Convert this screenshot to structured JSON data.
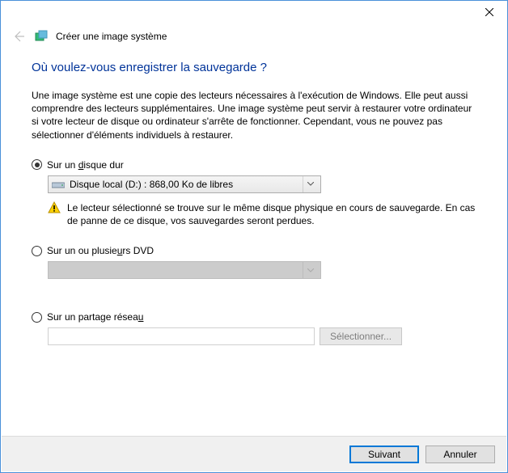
{
  "window": {
    "title": "Créer une image système"
  },
  "heading": "Où voulez-vous enregistrer la sauvegarde ?",
  "description": "Une image système est une copie des lecteurs nécessaires à l'exécution de Windows. Elle peut aussi comprendre des lecteurs supplémentaires. Une image système peut servir à restaurer votre ordinateur si votre lecteur de disque ou ordinateur s'arrête de fonctionner. Cependant, vous ne pouvez pas sélectionner d'éléments individuels à restaurer.",
  "options": {
    "hard_disk": {
      "label_pre": "Sur un ",
      "label_u": "d",
      "label_post": "isque dur",
      "selected_drive": "Disque local (D:) : 868,00 Ko de libres",
      "warning": "Le lecteur sélectionné se trouve sur le même disque physique en cours de sauvegarde. En cas de panne de ce disque, vos sauvegardes seront perdues."
    },
    "dvd": {
      "label_pre": "Sur un ou plusie",
      "label_u": "u",
      "label_post": "rs DVD"
    },
    "network": {
      "label_pre": "Sur un partage résea",
      "label_u": "u",
      "label_post": "",
      "select_button": "Sélectionner..."
    }
  },
  "footer": {
    "next": "Suivant",
    "cancel": "Annuler"
  }
}
